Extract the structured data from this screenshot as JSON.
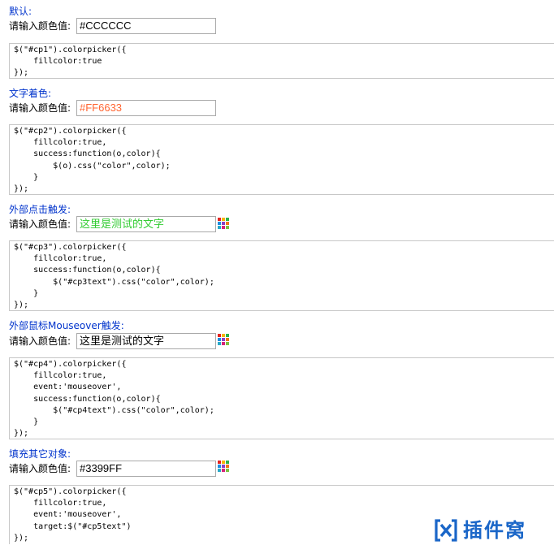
{
  "label_prompt": "请输入颜色值:",
  "sections": [
    {
      "title": "默认:",
      "input_value": "#CCCCCC",
      "input_color": "#000000",
      "code": [
        "$(\"#cp1\").colorpicker({",
        "    fillcolor:true",
        "});"
      ]
    },
    {
      "title": "文字着色:",
      "input_value": "#FF6633",
      "input_color": "#FF6633",
      "code": [
        "$(\"#cp2\").colorpicker({",
        "    fillcolor:true,",
        "    success:function(o,color){",
        "        $(o).css(\"color\",color);",
        "    }",
        "});"
      ]
    },
    {
      "title": "外部点击触发:",
      "input_value": "这里是测试的文字",
      "input_color": "#33CC33",
      "code": [
        "$(\"#cp3\").colorpicker({",
        "    fillcolor:true,",
        "    success:function(o,color){",
        "        $(\"#cp3text\").css(\"color\",color);",
        "    }",
        "});"
      ]
    },
    {
      "title": "外部鼠标Mouseover触发:",
      "input_value": "这里是测试的文字",
      "input_color": "#000000",
      "code": [
        "$(\"#cp4\").colorpicker({",
        "    fillcolor:true,",
        "    event:'mouseover',",
        "    success:function(o,color){",
        "        $(\"#cp4text\").css(\"color\",color);",
        "    }",
        "});"
      ]
    },
    {
      "title": "填充其它对象:",
      "input_value": "#3399FF",
      "input_color": "#000000",
      "code": [
        "$(\"#cp5\").colorpicker({",
        "    fillcolor:true,",
        "    event:'mouseover',",
        "    target:$(\"#cp5text\")",
        "});"
      ]
    }
  ],
  "picker_icon_colors": [
    "#e52420",
    "#f7b500",
    "#2db34a",
    "#1f8de0",
    "#8a3fc7",
    "#f2731c",
    "#27a9c8",
    "#d6247a",
    "#7bc142"
  ],
  "colors": {
    "section_title": "#0033CC",
    "input_border": "#A9A9A9",
    "code_border": "#C7C7C7",
    "watermark": "#1A66C8"
  },
  "watermark": {
    "text": "插件窝",
    "logo_icon": "bracket-x-logo-icon"
  }
}
